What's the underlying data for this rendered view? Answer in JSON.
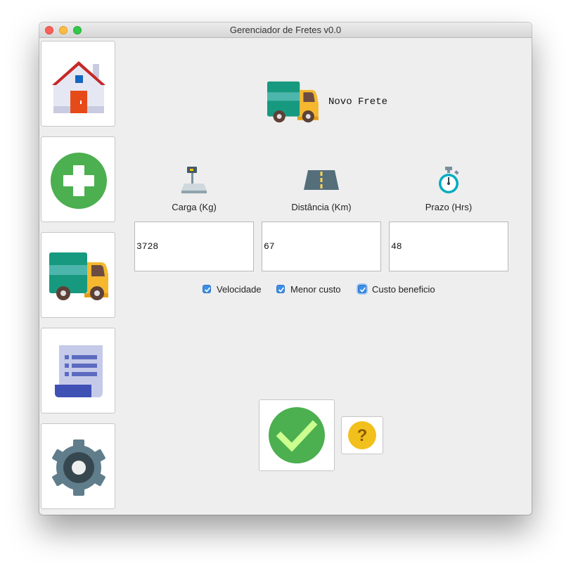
{
  "window": {
    "title": "Gerenciador de Fretes v0.0"
  },
  "sidebar": {
    "items": [
      {
        "name": "home",
        "icon": "house-icon"
      },
      {
        "name": "add",
        "icon": "plus-circle-icon"
      },
      {
        "name": "freight",
        "icon": "truck-icon"
      },
      {
        "name": "report",
        "icon": "document-list-icon"
      },
      {
        "name": "settings",
        "icon": "gear-icon"
      }
    ]
  },
  "header": {
    "title": "Novo Frete",
    "icon": "truck-icon"
  },
  "fields": [
    {
      "label": "Carga (Kg)",
      "value": "3728",
      "icon": "scale-icon"
    },
    {
      "label": "Distância (Km)",
      "value": "67",
      "icon": "road-icon"
    },
    {
      "label": "Prazo (Hrs)",
      "value": "48",
      "icon": "stopwatch-icon"
    }
  ],
  "options": [
    {
      "label": "Velocidade",
      "checked": true
    },
    {
      "label": "Menor custo",
      "checked": true
    },
    {
      "label": "Custo beneficio",
      "checked": true
    }
  ],
  "actions": {
    "confirm_icon": "check-circle-icon",
    "help_icon": "help-icon",
    "help_glyph": "?"
  },
  "colors": {
    "accent_green": "#4caf50",
    "check_blue": "#3d8fe6",
    "help_yellow": "#f2c01c",
    "truck_teal": "#1a9b88",
    "truck_yellow": "#f7b924"
  }
}
